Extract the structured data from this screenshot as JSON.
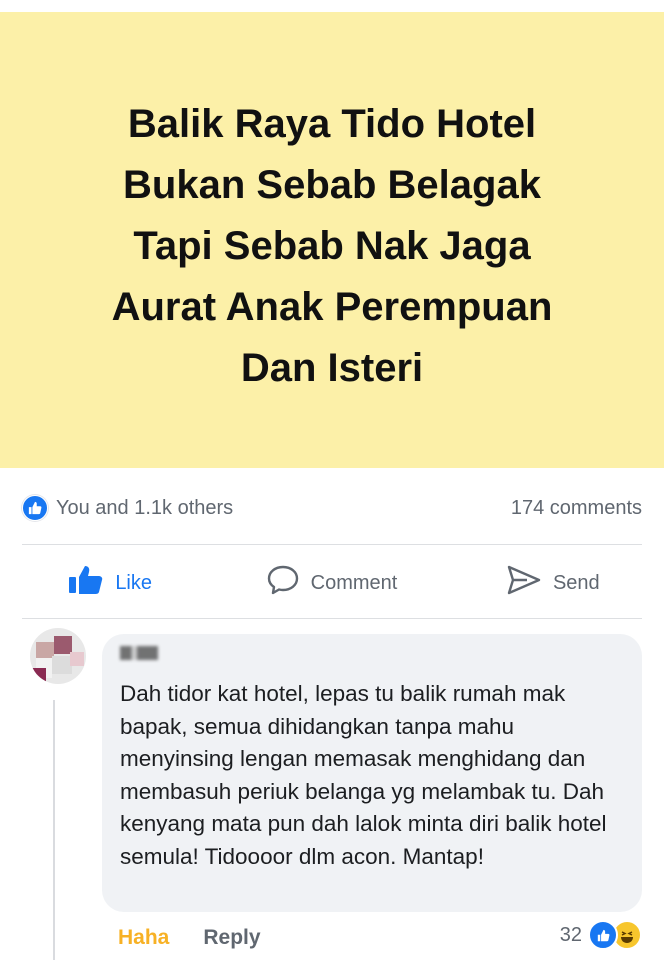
{
  "post": {
    "text_lines": [
      "Balik Raya Tido Hotel",
      "Bukan Sebab Belagak",
      "Tapi Sebab Nak Jaga",
      "Aurat Anak Perempuan",
      "Dan Isteri"
    ],
    "background_color": "#fcf0a8"
  },
  "stats": {
    "reactions_text": "You and 1.1k others",
    "comments_text": "174 comments",
    "reaction_icon": "like-icon"
  },
  "actions": {
    "like_label": "Like",
    "comment_label": "Comment",
    "send_label": "Send"
  },
  "comment": {
    "text": "Dah tidor kat hotel, lepas tu balik rumah mak bapak, semua dihidangkan tanpa mahu menyinsing lengan memasak menghidang dan membasuh periuk belanga yg melambak tu. Dah kenyang mata pun dah lalok minta diri balik hotel semula! Tidoooor dlm acon. Mantap!",
    "haha_label": "Haha",
    "reply_label": "Reply",
    "reaction_count": "32",
    "reaction_icons": [
      "like-icon",
      "haha-icon"
    ]
  },
  "colors": {
    "accent": "#1877f2",
    "haha": "#f7b125",
    "muted": "#606770"
  }
}
